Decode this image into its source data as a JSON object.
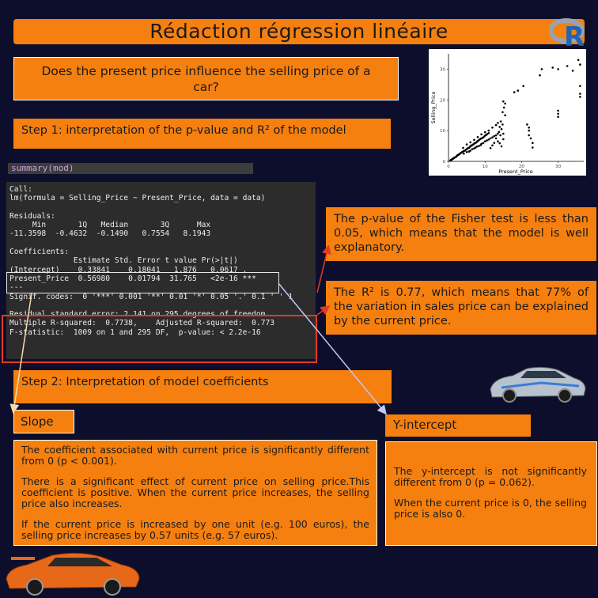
{
  "title": "Rédaction régression linéaire",
  "question": "Does the present price influence the selling price of a car?",
  "step1": "Step 1: interpretation of the p-value and R² of the model",
  "step2": "Step 2: Interpretation of model coefficients",
  "code_label": "summary(mod)",
  "console_output": "Call:\nlm(formula = Selling_Price ~ Present_Price, data = data)\n\nResiduals:\n     Min       1Q   Median       3Q      Max \n-11.3598  -0.4632  -0.1490   0.7554   8.1943 \n\nCoefficients:\n              Estimate Std. Error t value Pr(>|t|)    \n(Intercept)    0.33841    0.18041   1.876   0.0617 .  \nPresent_Price  0.56980    0.01794  31.765   <2e-16 ***\n---\nSignif. codes:  0 '***' 0.001 '**' 0.01 '*' 0.05 '.' 0.1 ' ' 1\n\nResidual standard error: 2.141 on 295 degrees of freedom\nMultiple R-squared:  0.7738,\tAdjusted R-squared:  0.773 \nF-statistic:  1009 on 1 and 295 DF,  p-value: < 2.2e-16",
  "pvalue_text": "The p-value of the Fisher test is less than 0.05, which means that the model is well explanatory.",
  "r2_text": "The R² is 0.77, which means that 77% of the variation in sales price can be explained by the current price.",
  "slope": {
    "heading": "Slope",
    "p1": "The coefficient associated with current price is significantly different from 0 (p < 0.001).",
    "p2": "There is a significant effect of current price on selling price.This coefficient is positive. When the current price increases, the selling price also increases.",
    "p3": "If the current price is increased by one unit (e.g. 100 euros), the selling price increases by 0.57 units (e.g. 57 euros)."
  },
  "yintercept": {
    "heading": "Y-intercept",
    "p1": "The y-intercept is not significantly different from 0 (p = 0.062).",
    "p2": "When the current price is 0, the selling price is also 0."
  },
  "logo_letter": "R",
  "chart_data": {
    "type": "scatter",
    "xlabel": "Present_Price",
    "ylabel": "Selling_Price",
    "xlim": [
      0,
      37
    ],
    "ylim": [
      0,
      35
    ],
    "x_ticks": [
      "0",
      "10",
      "20",
      "30"
    ],
    "y_ticks": [
      "0",
      "10",
      "20",
      "30"
    ],
    "grid": false,
    "points": [
      [
        0.5,
        0.3
      ],
      [
        0.6,
        0.4
      ],
      [
        0.7,
        0.5
      ],
      [
        0.8,
        0.5
      ],
      [
        0.9,
        0.6
      ],
      [
        1.0,
        0.7
      ],
      [
        1.1,
        0.8
      ],
      [
        1.2,
        0.9
      ],
      [
        1.3,
        0.9
      ],
      [
        1.5,
        1.1
      ],
      [
        1.6,
        1.2
      ],
      [
        1.8,
        1.3
      ],
      [
        2.0,
        1.4
      ],
      [
        2.2,
        1.7
      ],
      [
        2.4,
        1.9
      ],
      [
        2.6,
        2.1
      ],
      [
        2.8,
        2.2
      ],
      [
        3.0,
        2.4
      ],
      [
        3.2,
        2.6
      ],
      [
        3.5,
        2.8
      ],
      [
        3.7,
        3.0
      ],
      [
        4.0,
        3.2
      ],
      [
        4.2,
        3.4
      ],
      [
        4.5,
        3.5
      ],
      [
        4.8,
        3.8
      ],
      [
        5.0,
        4.0
      ],
      [
        5.2,
        4.2
      ],
      [
        5.5,
        4.4
      ],
      [
        5.7,
        4.5
      ],
      [
        5.9,
        4.8
      ],
      [
        6.1,
        5.0
      ],
      [
        6.3,
        5.2
      ],
      [
        6.5,
        5.3
      ],
      [
        6.8,
        5.5
      ],
      [
        7.0,
        5.8
      ],
      [
        7.2,
        5.9
      ],
      [
        7.5,
        6.1
      ],
      [
        7.7,
        6.3
      ],
      [
        7.9,
        6.5
      ],
      [
        8.1,
        6.7
      ],
      [
        8.4,
        7.0
      ],
      [
        8.6,
        7.2
      ],
      [
        8.9,
        7.4
      ],
      [
        9.2,
        7.6
      ],
      [
        9.5,
        7.8
      ],
      [
        9.8,
        8.1
      ],
      [
        10.0,
        8.4
      ],
      [
        10.3,
        8.6
      ],
      [
        10.6,
        8.9
      ],
      [
        11.0,
        9.2
      ],
      [
        4.2,
        2.5
      ],
      [
        5.0,
        3.0
      ],
      [
        5.6,
        3.2
      ],
      [
        6.0,
        3.5
      ],
      [
        6.5,
        4.0
      ],
      [
        7.0,
        4.2
      ],
      [
        7.4,
        4.5
      ],
      [
        7.8,
        4.8
      ],
      [
        8.3,
        5.0
      ],
      [
        8.8,
        5.3
      ],
      [
        9.0,
        5.7
      ],
      [
        9.5,
        6.0
      ],
      [
        10.0,
        6.5
      ],
      [
        10.5,
        6.8
      ],
      [
        11.0,
        7.1
      ],
      [
        11.5,
        7.5
      ],
      [
        12.0,
        7.8
      ],
      [
        12.5,
        8.2
      ],
      [
        13.0,
        8.5
      ],
      [
        13.5,
        9.0
      ],
      [
        4.0,
        4.4
      ],
      [
        5.0,
        5.5
      ],
      [
        6.0,
        6.2
      ],
      [
        7.0,
        7.0
      ],
      [
        8.0,
        7.9
      ],
      [
        9.0,
        8.8
      ],
      [
        10.0,
        9.5
      ],
      [
        11.0,
        10.0
      ],
      [
        12.0,
        11.0
      ],
      [
        13.0,
        11.8
      ],
      [
        13.5,
        12.5
      ],
      [
        14.0,
        11.2
      ],
      [
        14.3,
        13.0
      ],
      [
        14.5,
        10.5
      ],
      [
        14.8,
        12.0
      ],
      [
        15.0,
        9.0
      ],
      [
        13.0,
        7.5
      ],
      [
        13.5,
        6.5
      ],
      [
        14.0,
        5.9
      ],
      [
        14.5,
        4.9
      ],
      [
        12.5,
        6.0
      ],
      [
        12.0,
        5.2
      ],
      [
        11.5,
        4.3
      ],
      [
        15.0,
        7.2
      ],
      [
        14.2,
        8.5
      ],
      [
        13.8,
        9.6
      ],
      [
        15.5,
        15.0
      ],
      [
        14.8,
        16.0
      ],
      [
        15.2,
        17.5
      ],
      [
        15.5,
        18.8
      ],
      [
        15.0,
        19.5
      ],
      [
        22.0,
        8.5
      ],
      [
        22.0,
        10.0
      ],
      [
        22.0,
        11.0
      ],
      [
        22.5,
        7.5
      ],
      [
        23.0,
        6.0
      ],
      [
        23.0,
        4.5
      ],
      [
        21.5,
        12.0
      ],
      [
        18.0,
        22.5
      ],
      [
        19.0,
        23.0
      ],
      [
        20.5,
        24.5
      ],
      [
        25.0,
        28.0
      ],
      [
        25.5,
        30.0
      ],
      [
        28.5,
        30.5
      ],
      [
        30.0,
        30.0
      ],
      [
        32.5,
        31.0
      ],
      [
        30.0,
        16.5
      ],
      [
        30.0,
        15.5
      ],
      [
        30.0,
        14.5
      ],
      [
        36.0,
        21.0
      ],
      [
        36.0,
        22.0
      ],
      [
        36.0,
        24.5
      ],
      [
        36.0,
        31.5
      ],
      [
        35.5,
        33.0
      ],
      [
        34.0,
        29.5
      ]
    ]
  }
}
